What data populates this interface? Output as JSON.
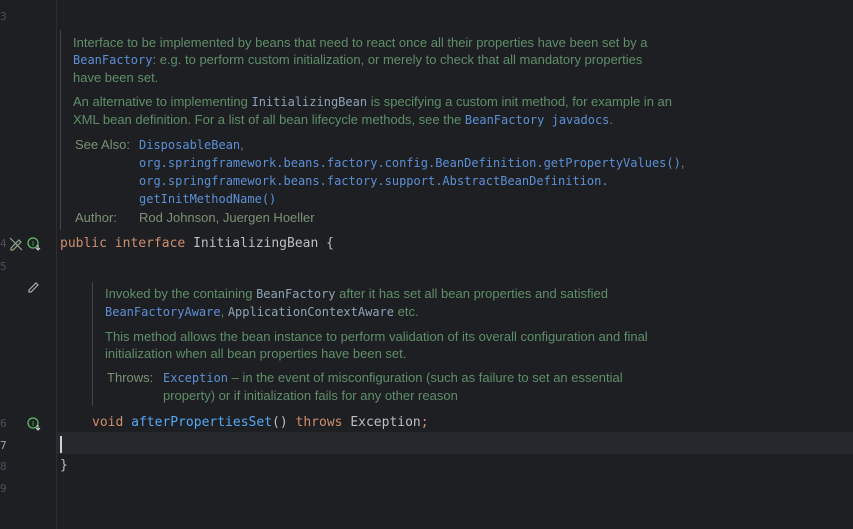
{
  "gutter": {
    "line_numbers": [
      "3",
      "4",
      "5",
      "6",
      "7",
      "8",
      "9"
    ]
  },
  "class_doc": {
    "p1_text_a": "Interface to be implemented by beans that need to react once all their properties have been set by a",
    "p1_code": "BeanFactory",
    "p1_text_b": ": e.g. to perform custom initialization, or merely to check that all mandatory properties",
    "p1_text_c": "have been set.",
    "p2_text_a": "An alternative to implementing ",
    "p2_code": "InitializingBean",
    "p2_text_b": " is specifying a custom init method, for example in an",
    "p2_text_c": "XML bean definition. For a list of all bean lifecycle methods, see the ",
    "p2_link": "BeanFactory javadocs",
    "p2_text_d": ".",
    "see_also_label": "See Also:",
    "see_also_1": "DisposableBean",
    "see_also_2": "org.springframework.beans.factory.config.BeanDefinition.getPropertyValues()",
    "see_also_3": "org.springframework.beans.factory.support.AbstractBeanDefinition.",
    "see_also_4": "getInitMethodName()",
    "author_label": "Author:",
    "author_value": "Rod Johnson, Juergen Hoeller"
  },
  "code": {
    "kw_public": "public",
    "kw_interface": "interface",
    "class_name": "InitializingBean",
    "open_brace": "{",
    "kw_void": "void",
    "method_name": "afterPropertiesSet",
    "parens": "()",
    "kw_throws": "throws",
    "exception_name": "Exception",
    "semicolon": ";",
    "close_brace": "}"
  },
  "method_doc": {
    "p1_text_a": "Invoked by the containing ",
    "p1_code_a": "BeanFactory",
    "p1_text_b": " after it has set all bean properties and satisfied",
    "p1_code_b": "BeanFactoryAware",
    "p1_sep": ", ",
    "p1_code_c": "ApplicationContextAware",
    "p1_text_c": " etc.",
    "p2_text_a": "This method allows the bean instance to perform validation of its overall configuration and final",
    "p2_text_b": "initialization when all bean properties have been set.",
    "throws_label": "Throws:",
    "throws_link": "Exception",
    "throws_text_a": " – in the event of misconfiguration (such as failure to set an essential",
    "throws_text_b": "property) or if initialization fails for any other reason"
  },
  "colors": {
    "background": "#1e1f22",
    "doc_text": "#5f8e6a",
    "keyword": "#cf8e6d",
    "method": "#56a8f5",
    "link": "#5c8fd6"
  }
}
